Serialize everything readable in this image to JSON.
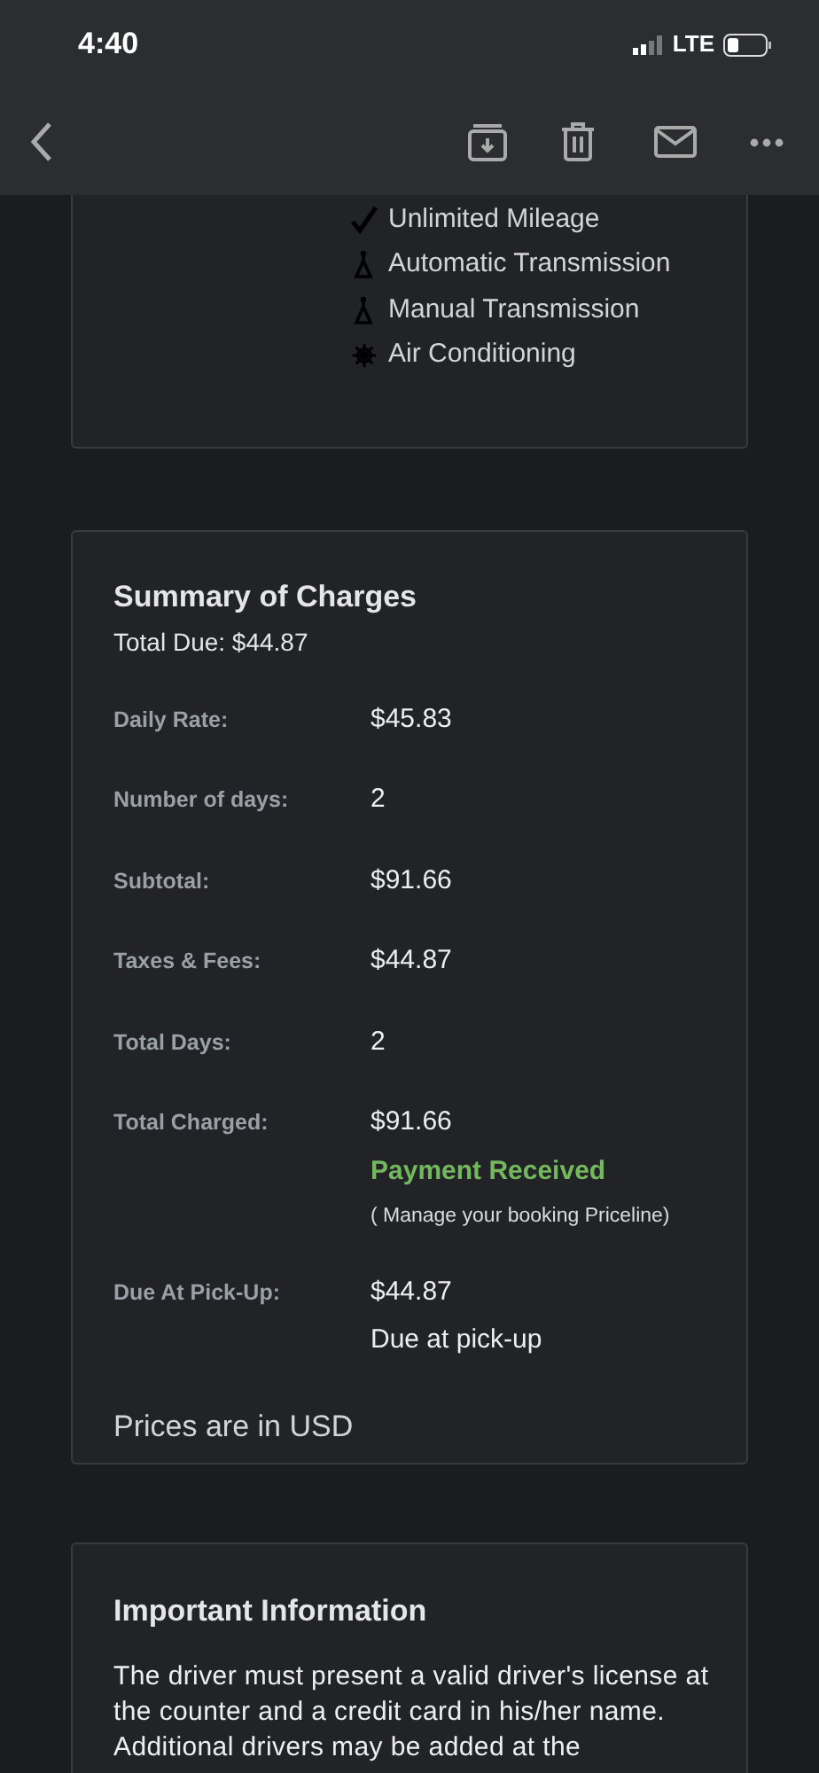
{
  "status_bar": {
    "time": "4:40",
    "network": "LTE"
  },
  "features": [
    {
      "kind": "check",
      "label": "Unlimited Mileage"
    },
    {
      "kind": "transmission",
      "label": "Automatic Transmission"
    },
    {
      "kind": "transmission",
      "label": "Manual Transmission"
    },
    {
      "kind": "snowflake",
      "label": "Air Conditioning"
    }
  ],
  "summary": {
    "title": "Summary of Charges",
    "total_due": "Total Due: $44.87",
    "rows": [
      {
        "label": "Daily Rate:",
        "value": "$45.83"
      },
      {
        "label": "Number of days:",
        "value": "2"
      },
      {
        "label": "Subtotal:",
        "value": "$91.66"
      },
      {
        "label": "Taxes & Fees:",
        "value": "$44.87"
      },
      {
        "label": "Total Days:",
        "value": "2"
      },
      {
        "label": "Total Charged:",
        "value": "$91.66",
        "status": "Payment Received",
        "note": "( Manage your booking Priceline)"
      },
      {
        "label": "Due At Pick-Up:",
        "value": "$44.87",
        "note2": "Due at pick-up"
      }
    ],
    "currency_note": "Prices are in USD"
  },
  "important": {
    "title": "Important Information",
    "text": "The driver must present a valid driver's license at the counter and a credit card in his/her name. Additional drivers may be added at the"
  }
}
